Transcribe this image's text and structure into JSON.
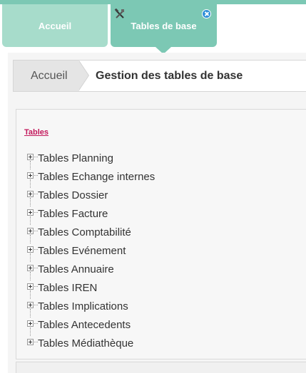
{
  "tabs": [
    {
      "label": "Accueil"
    },
    {
      "label": "Tables de base"
    }
  ],
  "icons": {
    "tab_tool": "tools-icon",
    "tab_close": "close-icon",
    "expander": "plus-square-icon"
  },
  "colors": {
    "tab_active": "#7cc8b4",
    "tab_inactive": "#a7dccb",
    "link_title": "#c2185b",
    "close_badge": "#2f8fd8"
  },
  "breadcrumb": {
    "home": "Accueil",
    "current": "Gestion des tables de base"
  },
  "panel": {
    "title": "Tables"
  },
  "tree": {
    "items": [
      {
        "label": "Tables Planning"
      },
      {
        "label": "Tables Echange internes"
      },
      {
        "label": "Tables Dossier"
      },
      {
        "label": "Tables Facture"
      },
      {
        "label": "Tables Comptabilité"
      },
      {
        "label": "Tables Evénement"
      },
      {
        "label": "Tables Annuaire"
      },
      {
        "label": "Tables IREN"
      },
      {
        "label": "Tables Implications"
      },
      {
        "label": "Tables Antecedents"
      },
      {
        "label": "Tables Médiathèque"
      }
    ]
  }
}
